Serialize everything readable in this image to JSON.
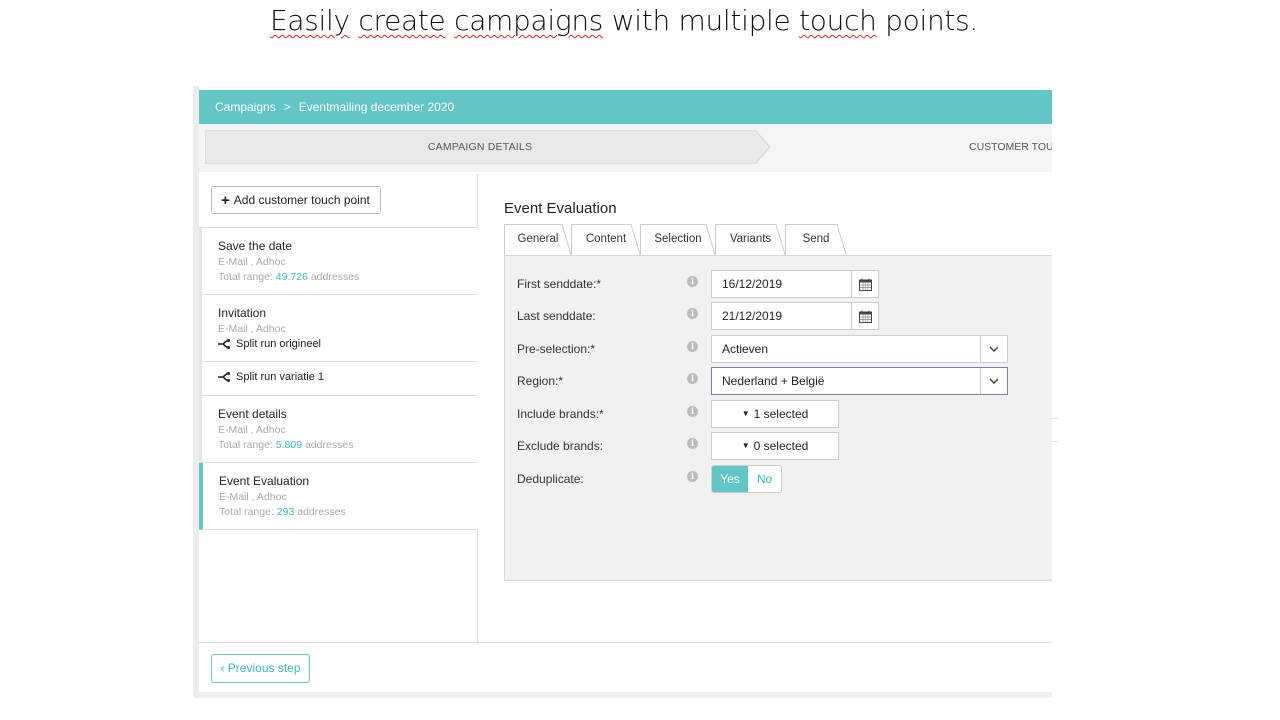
{
  "headline": {
    "part1": "Easily",
    "part2": "create",
    "part3": "campaigns",
    "part4": "with multiple",
    "part5": "touch",
    "part6": "points."
  },
  "breadcrumb": {
    "root": "Campaigns",
    "separator": ">",
    "current": "Eventmailing december 2020"
  },
  "steps": {
    "step1": "CAMPAIGN DETAILS",
    "step2": "CUSTOMER TOUC"
  },
  "sidebar": {
    "add_button_label": "Add customer touch point",
    "items": [
      {
        "name": "Save the date",
        "meta": "E-Mail , Adhoc",
        "range_prefix": "Total range:",
        "range_value": "49.726",
        "range_suffix": "addresses"
      },
      {
        "name": "Invitation",
        "meta": "E-Mail , Adhoc",
        "split": "Split run origineel"
      },
      {
        "split": "Split run variatie 1"
      },
      {
        "name": "Event details",
        "meta": "E-Mail , Adhoc",
        "range_prefix": "Total range:",
        "range_value": "5.809",
        "range_suffix": "addresses"
      },
      {
        "name": "Event Evaluation",
        "meta": "E-Mail , Adhoc",
        "range_prefix": "Total range:",
        "range_value": "293",
        "range_suffix": "addresses"
      }
    ]
  },
  "main": {
    "title": "Event Evaluation",
    "tabs": [
      "General",
      "Content",
      "Selection",
      "Variants",
      "Send"
    ],
    "active_tab": "General",
    "form": {
      "first_senddate_label": "First senddate:*",
      "first_senddate_value": "16/12/2019",
      "last_senddate_label": "Last senddate:",
      "last_senddate_value": "21/12/2019",
      "preselection_label": "Pre-selection:*",
      "preselection_value": "Actieven",
      "region_label": "Region:*",
      "region_value": "Nederland + België",
      "include_brands_label": "Include brands:*",
      "include_brands_value": "1 selected",
      "exclude_brands_label": "Exclude brands:",
      "exclude_brands_value": "0 selected",
      "deduplicate_label": "Deduplicate:",
      "deduplicate_yes": "Yes",
      "deduplicate_no": "No",
      "deduplicate_selected": "Yes"
    }
  },
  "footer": {
    "previous_label": "‹ Previous step"
  },
  "colors": {
    "accent": "#63c6c6",
    "accent_text": "#3bb7c2",
    "panel_bg": "#f1f1f1"
  },
  "icons": {
    "info": "info-icon",
    "calendar": "calendar-icon",
    "chevron": "chevron-down-icon",
    "split": "split-run-icon",
    "plus": "plus-icon"
  }
}
